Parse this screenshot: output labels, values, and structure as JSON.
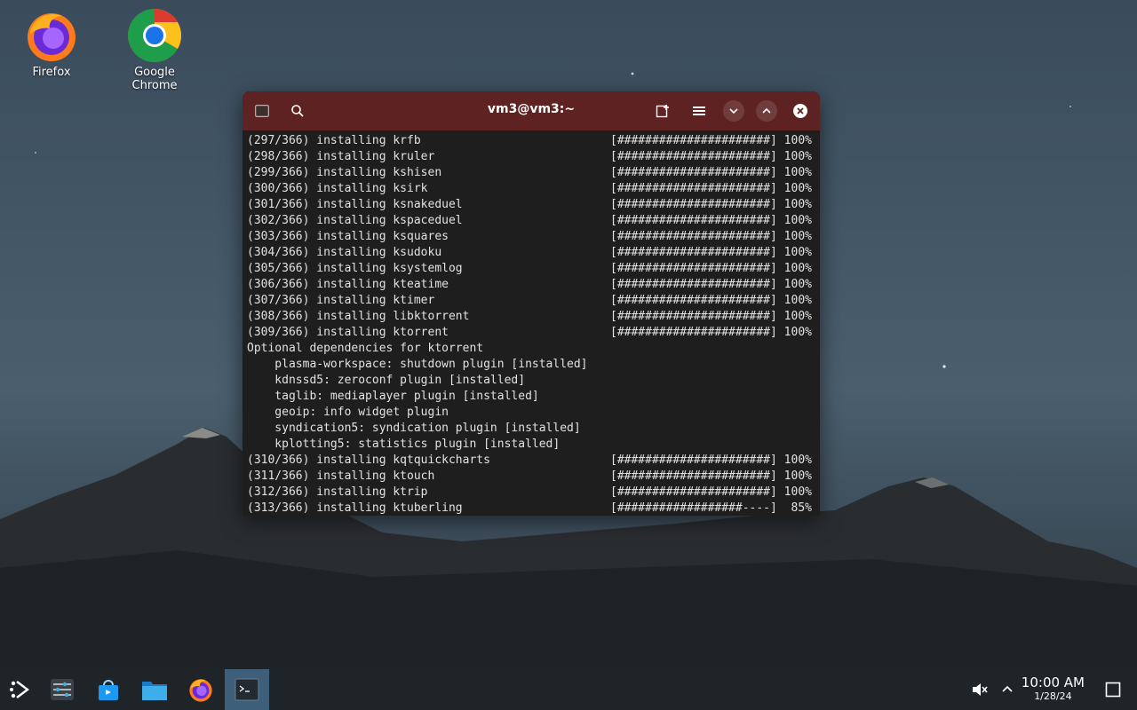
{
  "desktop": {
    "icons": [
      {
        "label": "Firefox"
      },
      {
        "label": "Google Chrome"
      }
    ]
  },
  "terminal": {
    "title": "vm3@vm3:~",
    "lines": [
      {
        "text": "(297/366) installing krfb",
        "bar": "[######################] 100%"
      },
      {
        "text": "(298/366) installing kruler",
        "bar": "[######################] 100%"
      },
      {
        "text": "(299/366) installing kshisen",
        "bar": "[######################] 100%"
      },
      {
        "text": "(300/366) installing ksirk",
        "bar": "[######################] 100%"
      },
      {
        "text": "(301/366) installing ksnakeduel",
        "bar": "[######################] 100%"
      },
      {
        "text": "(302/366) installing kspaceduel",
        "bar": "[######################] 100%"
      },
      {
        "text": "(303/366) installing ksquares",
        "bar": "[######################] 100%"
      },
      {
        "text": "(304/366) installing ksudoku",
        "bar": "[######################] 100%"
      },
      {
        "text": "(305/366) installing ksystemlog",
        "bar": "[######################] 100%"
      },
      {
        "text": "(306/366) installing kteatime",
        "bar": "[######################] 100%"
      },
      {
        "text": "(307/366) installing ktimer",
        "bar": "[######################] 100%"
      },
      {
        "text": "(308/366) installing libktorrent",
        "bar": "[######################] 100%"
      },
      {
        "text": "(309/366) installing ktorrent",
        "bar": "[######################] 100%"
      },
      {
        "text": "Optional dependencies for ktorrent",
        "bar": ""
      },
      {
        "text": "    plasma-workspace: shutdown plugin [installed]",
        "bar": ""
      },
      {
        "text": "    kdnssd5: zeroconf plugin [installed]",
        "bar": ""
      },
      {
        "text": "    taglib: mediaplayer plugin [installed]",
        "bar": ""
      },
      {
        "text": "    geoip: info widget plugin",
        "bar": ""
      },
      {
        "text": "    syndication5: syndication plugin [installed]",
        "bar": ""
      },
      {
        "text": "    kplotting5: statistics plugin [installed]",
        "bar": ""
      },
      {
        "text": "(310/366) installing kqtquickcharts",
        "bar": "[######################] 100%"
      },
      {
        "text": "(311/366) installing ktouch",
        "bar": "[######################] 100%"
      },
      {
        "text": "(312/366) installing ktrip",
        "bar": "[######################] 100%"
      },
      {
        "text": "(313/366) installing ktuberling",
        "bar": "[##################----]  85%"
      }
    ]
  },
  "taskbar": {
    "clock_time": "10:00 AM",
    "clock_date": "1/28/24"
  },
  "icons": {
    "terminal_tab": "terminal-icon",
    "search": "search-icon",
    "new_tab": "new-tab-icon",
    "menu": "hamburger-menu-icon",
    "minimize": "minimize-icon",
    "maximize": "maximize-icon",
    "close": "close-icon",
    "launcher": "app-launcher-icon",
    "settings": "system-settings-icon",
    "discover": "discover-store-icon",
    "files": "file-manager-icon",
    "firefox": "firefox-icon",
    "terminal": "terminal-icon",
    "volume": "volume-muted-icon",
    "tray": "tray-expand-icon",
    "show_desktop": "show-desktop-icon"
  },
  "colors": {
    "titlebar": "#5e2222",
    "terminal_bg": "#1e1e1e",
    "taskbar": "#1f2429",
    "active_task": "#3d5f7a"
  }
}
